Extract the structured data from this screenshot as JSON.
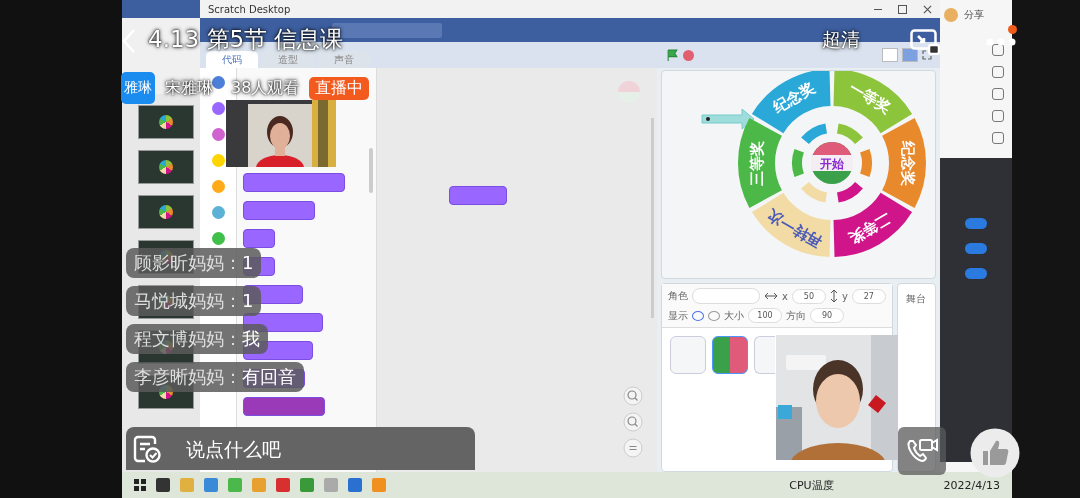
{
  "live": {
    "title": "4.13 第5节 信息课",
    "quality": "超清",
    "host_badge": "雅琳",
    "host_name": "宋雅琳",
    "viewers": "38人观看",
    "status": "直播中"
  },
  "comments": [
    {
      "user": "顾影昕妈妈：",
      "text": "1"
    },
    {
      "user": "马悦城妈妈：",
      "text": "1"
    },
    {
      "user": "程文博妈妈：",
      "text": "我"
    },
    {
      "user": "李彦晰妈妈：",
      "text": "有回音"
    }
  ],
  "comment_input": {
    "placeholder": "说点什么吧"
  },
  "shared_screen": {
    "window_title": "Scratch Desktop",
    "tabs": [
      {
        "label": "代码",
        "selected": true
      },
      {
        "label": "造型",
        "selected": false
      },
      {
        "label": "声音",
        "selected": false
      }
    ],
    "categories": [
      {
        "color": "#4c7fd8"
      },
      {
        "color": "#9966ff"
      },
      {
        "color": "#cf63cf"
      },
      {
        "color": "#ffd500"
      },
      {
        "color": "#ffab19"
      },
      {
        "color": "#5cb1d6"
      },
      {
        "color": "#40bf4a"
      }
    ],
    "wheel": {
      "center": "开始",
      "segments": [
        {
          "label": "一等奖",
          "color": "#8cc43c"
        },
        {
          "label": "纪念奖",
          "color": "#e8892c"
        },
        {
          "label": "二等奖",
          "color": "#d0158a"
        },
        {
          "label": "再转一次",
          "color": "#f2dba4"
        },
        {
          "label": "三等奖",
          "color": "#4cb848"
        },
        {
          "label": "纪念奖",
          "color": "#2aa8d8"
        }
      ]
    },
    "sprite_info": {
      "sprite_label": "角色",
      "x_label": "x",
      "x_value": "50",
      "y_label": "y",
      "y_value": "27",
      "show_label": "显示",
      "size_label": "大小",
      "size_value": "100",
      "direction_label": "方向",
      "direction_value": "90"
    },
    "stage_label": "舞台",
    "side_panel": {
      "share": "分享",
      "toggles": [
        {
          "on": true
        },
        {
          "on": true
        },
        {
          "on": true
        }
      ]
    },
    "taskbar": {
      "cpu": "CPU温度",
      "date": "2022/4/13"
    }
  }
}
